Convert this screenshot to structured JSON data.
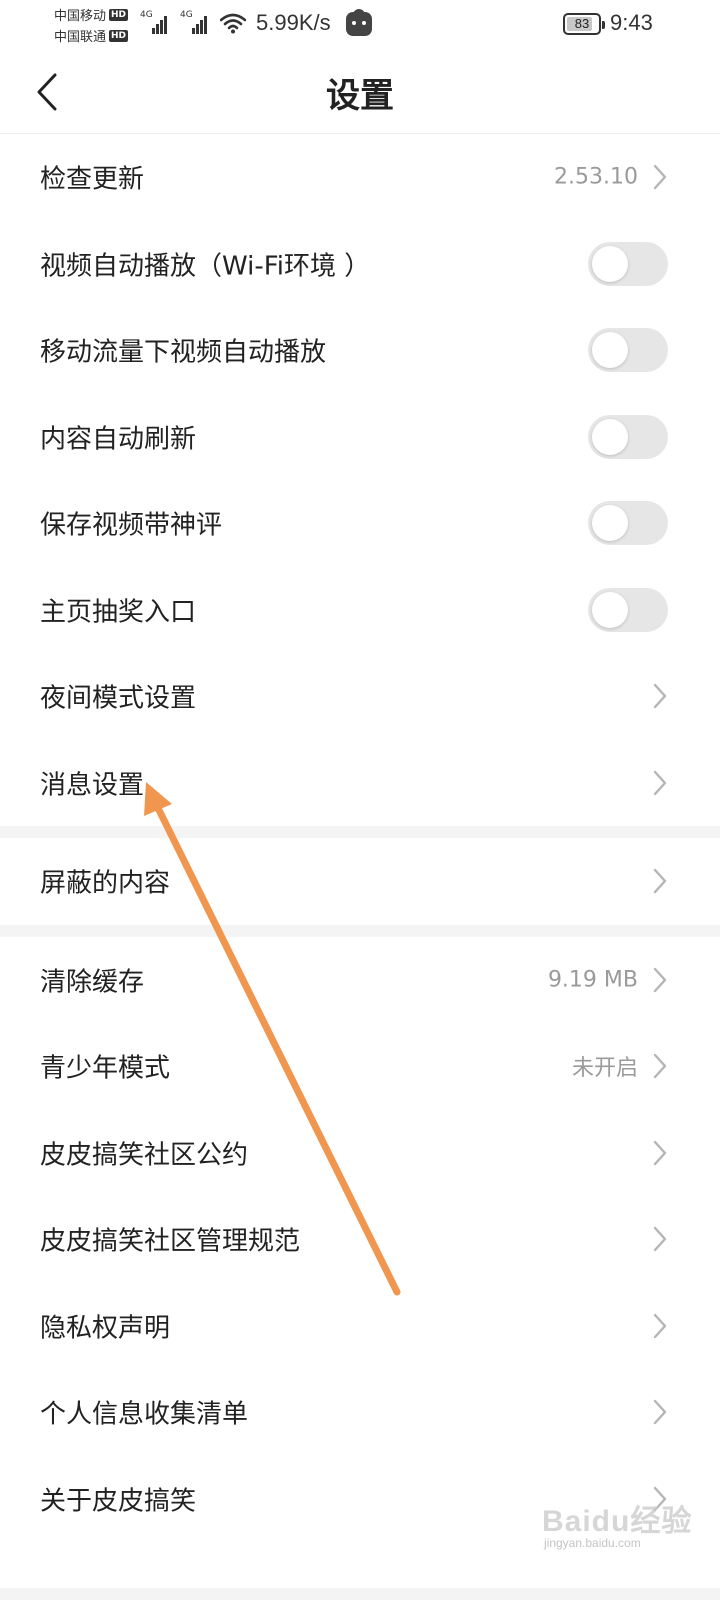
{
  "status_bar": {
    "carrier_1": "中国移动",
    "carrier_2": "中国联通",
    "hd": "HD",
    "net_type": "4G",
    "speed": "5.99K/s",
    "battery": "83",
    "battery_level": 0.83,
    "time": "9:43"
  },
  "header": {
    "title": "设置"
  },
  "group1": [
    {
      "label": "检查更新",
      "value": "2.53.10",
      "control": "chevron"
    },
    {
      "label": "视频自动播放（Wi-Fi环境 ）",
      "control": "toggle",
      "on": false
    },
    {
      "label": "移动流量下视频自动播放",
      "control": "toggle",
      "on": false
    },
    {
      "label": "内容自动刷新",
      "control": "toggle",
      "on": false
    },
    {
      "label": "保存视频带神评",
      "control": "toggle",
      "on": false
    },
    {
      "label": "主页抽奖入口",
      "control": "toggle",
      "on": false
    },
    {
      "label": "夜间模式设置",
      "control": "chevron"
    },
    {
      "label": "消息设置",
      "control": "chevron"
    }
  ],
  "group2": [
    {
      "label": "屏蔽的内容",
      "control": "chevron"
    }
  ],
  "group3": [
    {
      "label": "清除缓存",
      "value": "9.19 MB",
      "control": "chevron"
    },
    {
      "label": "青少年模式",
      "value": "未开启",
      "control": "chevron"
    },
    {
      "label": "皮皮搞笑社区公约",
      "control": "chevron"
    },
    {
      "label": "皮皮搞笑社区管理规范",
      "control": "chevron"
    },
    {
      "label": "隐私权声明",
      "control": "chevron"
    },
    {
      "label": "个人信息收集清单",
      "control": "chevron"
    },
    {
      "label": "关于皮皮搞笑",
      "control": "chevron"
    }
  ],
  "annotation": {
    "color": "#f0964f"
  },
  "watermark": {
    "brand": "Baidu经验",
    "site": "jingyan.baidu.com"
  },
  "colors": {
    "toggle_off": "#e6e6e6",
    "secondary_text": "#9a9a9a",
    "divider": "#f4f4f4"
  }
}
